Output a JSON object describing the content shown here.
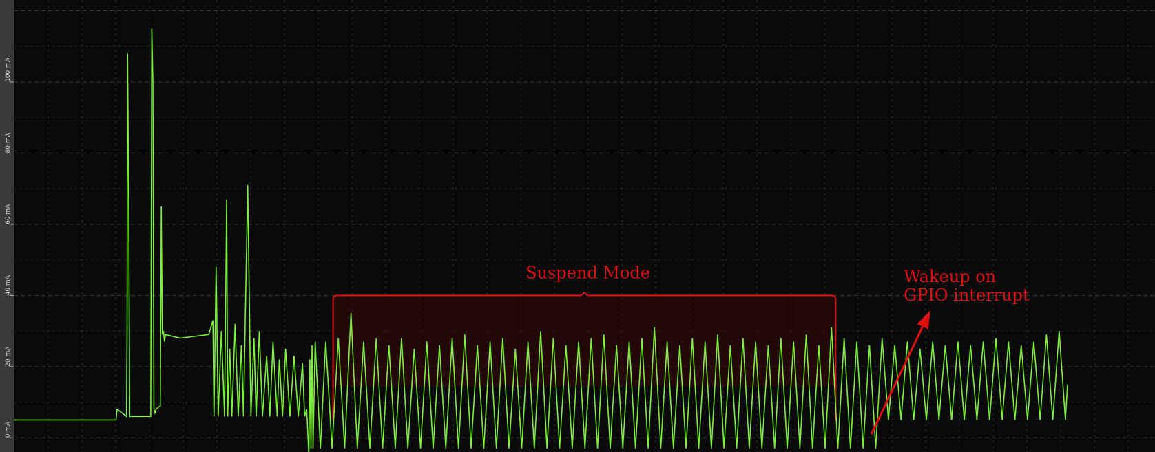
{
  "chart_data": {
    "type": "line",
    "title": "",
    "xlabel": "",
    "ylabel": "",
    "y_unit": "mA",
    "ylim": [
      -4,
      123
    ],
    "xlim": [
      0,
      1000
    ],
    "y_ticks": [
      {
        "value": 0,
        "label": "0 mA"
      },
      {
        "value": 20,
        "label": "20 mA"
      },
      {
        "value": 40,
        "label": "40 mA"
      },
      {
        "value": 60,
        "label": "60 mA"
      },
      {
        "value": 80,
        "label": "80 mA"
      },
      {
        "value": 100,
        "label": "100 mA"
      }
    ],
    "grid": true,
    "colors": {
      "trace": "#7cf03a",
      "annotation": "#e01010",
      "grid": "#3c3c3c"
    },
    "series": [
      {
        "x": [
          0,
          97,
          98,
          107,
          107.5,
          108,
          109,
          110,
          115,
          130,
          131,
          132,
          133,
          134,
          135,
          139,
          140,
          141,
          142,
          143,
          144,
          158,
          185,
          189,
          190,
          192,
          194,
          197,
          200,
          202,
          203,
          205,
          207,
          210,
          213,
          216,
          218,
          222,
          225,
          228,
          230,
          233,
          236,
          240,
          243,
          246,
          250,
          252,
          255,
          258,
          262,
          266,
          270,
          274,
          276,
          278,
          280,
          281,
          282,
          283,
          284,
          286,
          291,
          296,
          302,
          308,
          314,
          320,
          326,
          332,
          338,
          344,
          350,
          356,
          362,
          368,
          374,
          380,
          386,
          392,
          398,
          404,
          410,
          416,
          422,
          428,
          434,
          440,
          446,
          452,
          458,
          464,
          470,
          476,
          482,
          488,
          494,
          500,
          506,
          512,
          518,
          524,
          530,
          536,
          542,
          548,
          554,
          560,
          566,
          572,
          578,
          584,
          590,
          596,
          602,
          608,
          614,
          620,
          626,
          632,
          638,
          644,
          650,
          656,
          662,
          668,
          674,
          680,
          686,
          692,
          698,
          704,
          710,
          716,
          722,
          728,
          734,
          740,
          746,
          752,
          758,
          764,
          770,
          776,
          782,
          788,
          794,
          800,
          806,
          812,
          818,
          824,
          830,
          836,
          842,
          848,
          854,
          860,
          866,
          872,
          878,
          884,
          890,
          896,
          902,
          908,
          914,
          920,
          926,
          932,
          938,
          944,
          950,
          956,
          962,
          968,
          974,
          980,
          986,
          992,
          998,
          1000
        ],
        "y": [
          5,
          5,
          8,
          6,
          30,
          108,
          70,
          6,
          6,
          6,
          115,
          100,
          8,
          7,
          8,
          9,
          65,
          29,
          30,
          27,
          29,
          28,
          29,
          33,
          6,
          48,
          6,
          30,
          6,
          67,
          6,
          25,
          6,
          32,
          6,
          26,
          6,
          71,
          6,
          28,
          6,
          30,
          6,
          23,
          6,
          27,
          6,
          22,
          6,
          25,
          6,
          23,
          6,
          21,
          6,
          8,
          -5,
          22,
          -3,
          26,
          -3,
          27,
          -3,
          27,
          -3,
          28,
          -3,
          35,
          -3,
          27,
          -3,
          28,
          -3,
          26,
          -3,
          28,
          -3,
          25,
          -3,
          27,
          -3,
          26,
          -3,
          28,
          -3,
          29,
          -3,
          26,
          -3,
          27,
          -3,
          28,
          -3,
          25,
          -3,
          27,
          -3,
          30,
          -3,
          28,
          -3,
          26,
          -3,
          27,
          -3,
          28,
          -3,
          29,
          -3,
          26,
          -3,
          27,
          -3,
          28,
          -3,
          31,
          -3,
          27,
          -3,
          26,
          -3,
          28,
          -3,
          27,
          -3,
          29,
          -3,
          26,
          -3,
          28,
          -3,
          27,
          -3,
          26,
          -3,
          28,
          -3,
          27,
          -3,
          29,
          -3,
          26,
          -3,
          31,
          -3,
          28,
          -3,
          27,
          -3,
          26,
          -3,
          28,
          5,
          26,
          5,
          27,
          5,
          25,
          5,
          27,
          5,
          26,
          5,
          27,
          5,
          26,
          5,
          27,
          5,
          28,
          5,
          27,
          5,
          26,
          5,
          27,
          5,
          29,
          5,
          30,
          5,
          15
        ]
      }
    ],
    "annotations": [
      {
        "id": "suspend",
        "text": "Suspend Mode",
        "x_start": 303,
        "x_end": 780,
        "y_top": 40,
        "y_bottom": -3
      },
      {
        "id": "wakeup",
        "line1": "Wakeup on",
        "line2": "GPIO interrupt",
        "x": 819,
        "y": 37
      }
    ]
  }
}
